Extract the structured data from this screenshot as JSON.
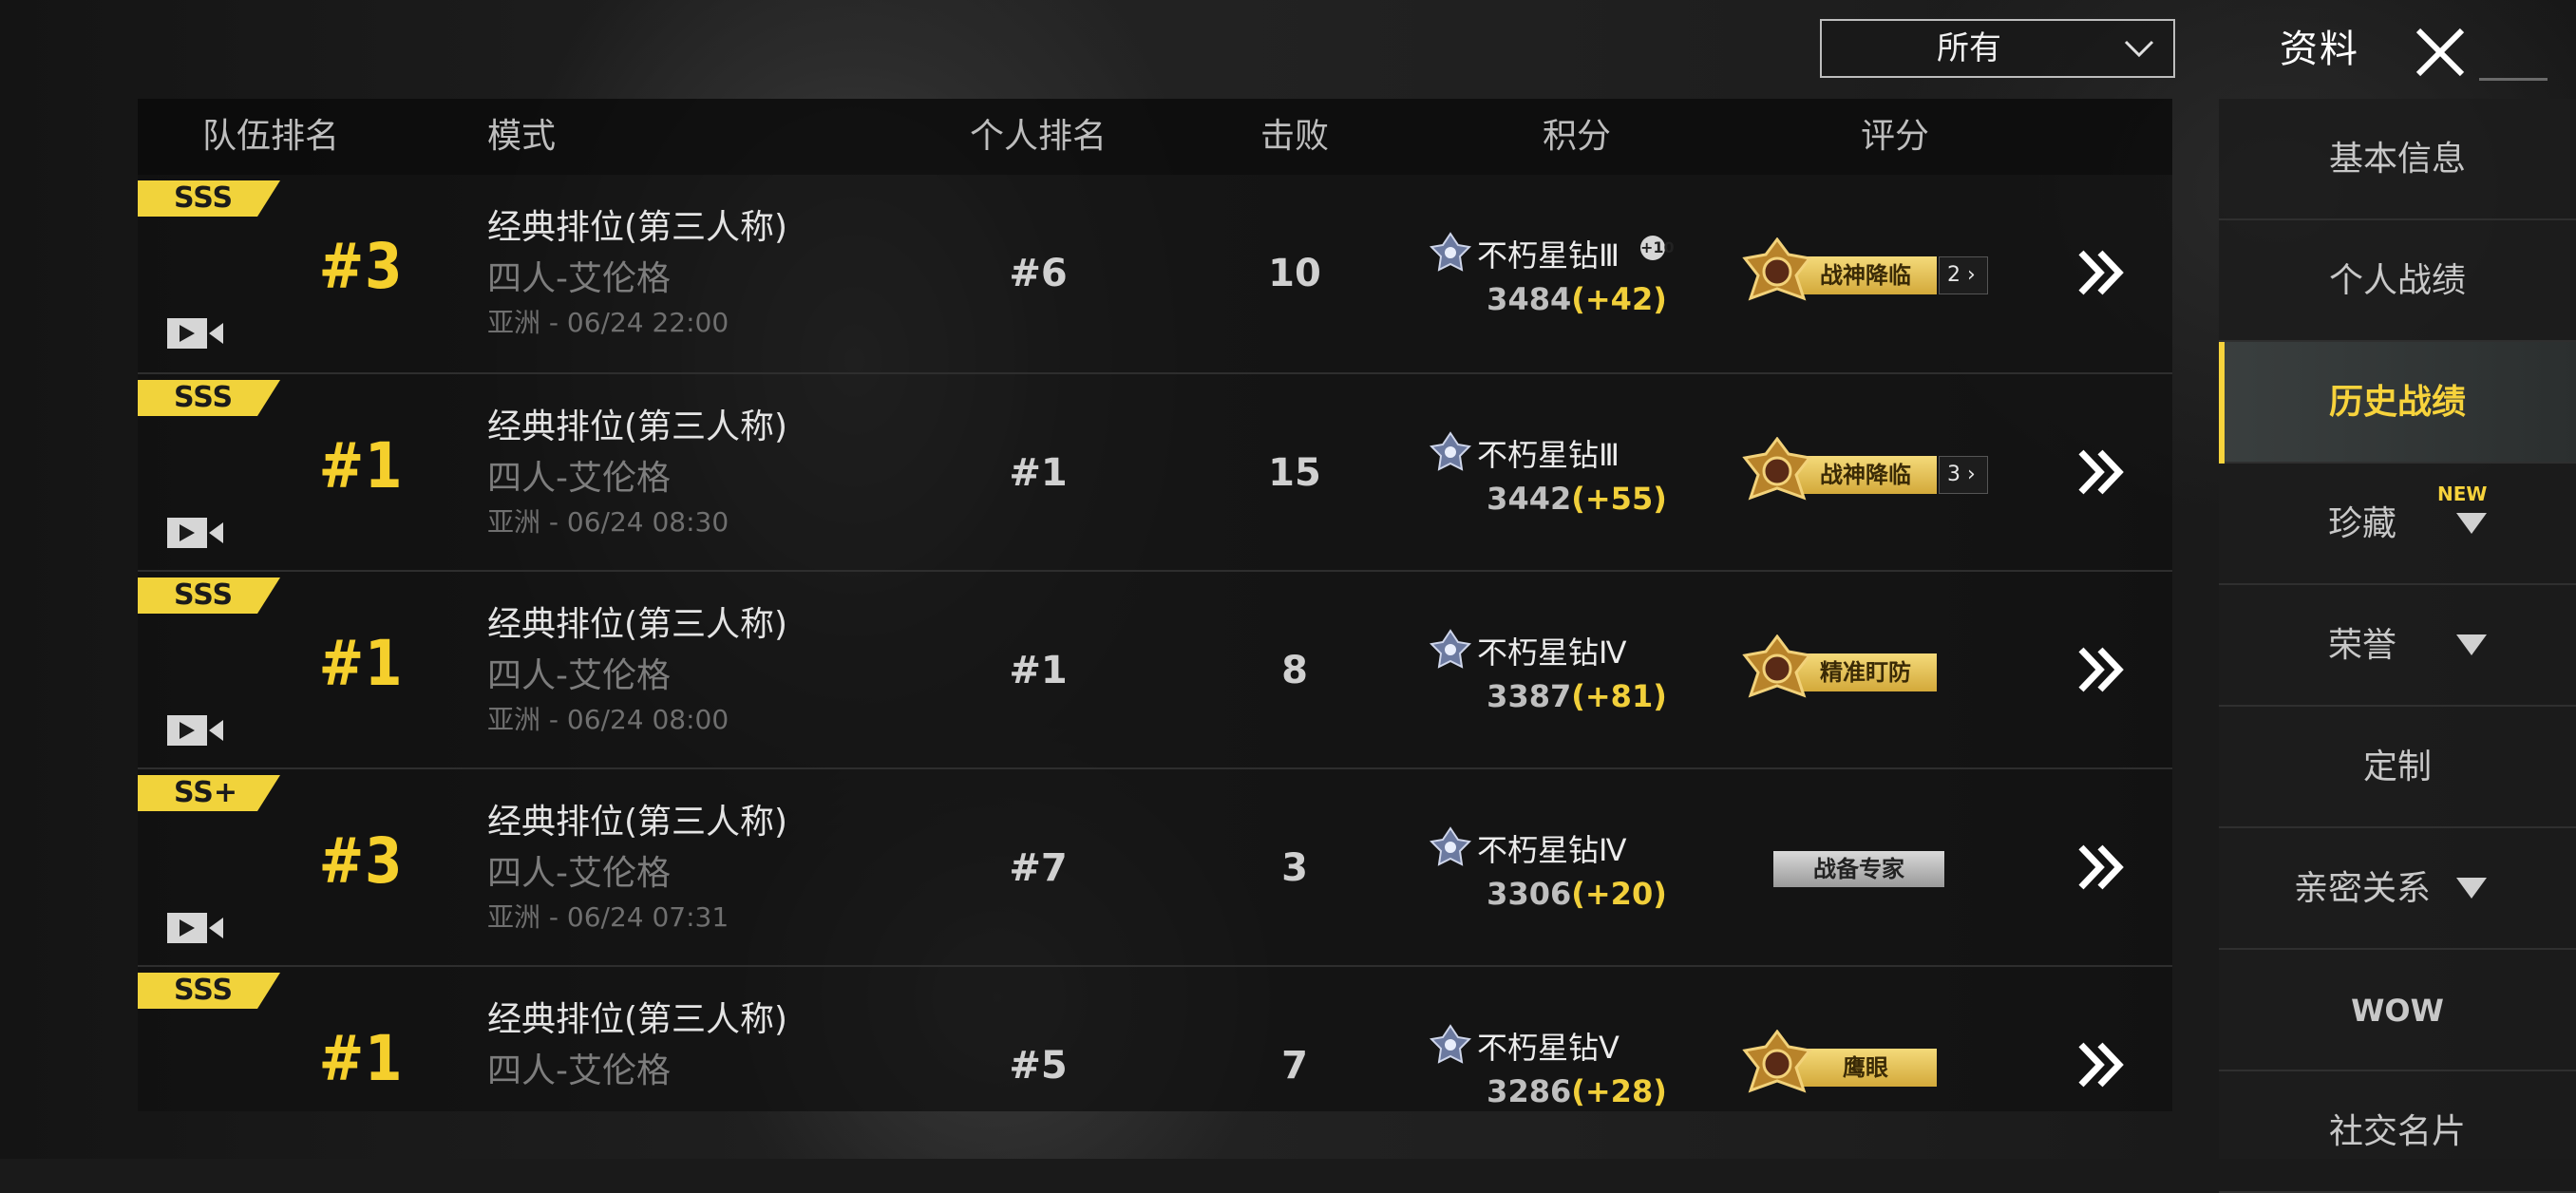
{
  "header": {
    "filter_value": "所有",
    "title": "资料"
  },
  "table": {
    "columns": [
      "队伍排名",
      "模式",
      "个人排名",
      "击败",
      "积分",
      "评分"
    ],
    "rows": [
      {
        "grade": "SSS",
        "team_rank": "#3",
        "mode": "经典排位(第三人称)",
        "map": "四人-艾伦格",
        "server_time": "亚洲 - 06/24 22:00",
        "personal_rank": "#6",
        "kills": "10",
        "tier": "不朽星钻Ⅲ",
        "tier_badge": "+10",
        "score": "3484",
        "score_delta": "(+42)",
        "medal": "战神降临",
        "medal_count": "2",
        "medal_type": "gold"
      },
      {
        "grade": "SSS",
        "team_rank": "#1",
        "mode": "经典排位(第三人称)",
        "map": "四人-艾伦格",
        "server_time": "亚洲 - 06/24 08:30",
        "personal_rank": "#1",
        "kills": "15",
        "tier": "不朽星钻Ⅲ",
        "tier_badge": "",
        "score": "3442",
        "score_delta": "(+55)",
        "medal": "战神降临",
        "medal_count": "3",
        "medal_type": "gold"
      },
      {
        "grade": "SSS",
        "team_rank": "#1",
        "mode": "经典排位(第三人称)",
        "map": "四人-艾伦格",
        "server_time": "亚洲 - 06/24 08:00",
        "personal_rank": "#1",
        "kills": "8",
        "tier": "不朽星钻Ⅳ",
        "tier_badge": "",
        "score": "3387",
        "score_delta": "(+81)",
        "medal": "精准盯防",
        "medal_count": "",
        "medal_type": "gold"
      },
      {
        "grade": "SS+",
        "team_rank": "#3",
        "mode": "经典排位(第三人称)",
        "map": "四人-艾伦格",
        "server_time": "亚洲 - 06/24 07:31",
        "personal_rank": "#7",
        "kills": "3",
        "tier": "不朽星钻Ⅳ",
        "tier_badge": "",
        "score": "3306",
        "score_delta": "(+20)",
        "medal": "战备专家",
        "medal_count": "",
        "medal_type": "plain"
      },
      {
        "grade": "SSS",
        "team_rank": "#1",
        "mode": "经典排位(第三人称)",
        "map": "四人-艾伦格",
        "server_time": "",
        "personal_rank": "#5",
        "kills": "7",
        "tier": "不朽星钻Ⅴ",
        "tier_badge": "",
        "score": "3286",
        "score_delta": "(+28)",
        "medal": "鹰眼",
        "medal_count": "",
        "medal_type": "gold"
      }
    ]
  },
  "sidebar": {
    "items": [
      {
        "label": "基本信息"
      },
      {
        "label": "个人战绩"
      },
      {
        "label": "历史战绩",
        "active": true
      },
      {
        "label": "珍藏",
        "tag": "NEW",
        "has_arrow": true
      },
      {
        "label": "荣誉",
        "has_arrow": true
      },
      {
        "label": "定制"
      },
      {
        "label": "亲密关系",
        "has_arrow": true
      },
      {
        "label": "WOW"
      },
      {
        "label": "社交名片"
      }
    ]
  },
  "colors": {
    "accent_yellow": "#f5cf2c",
    "grade_yellow": "#f1d33b",
    "panel": "#1c1c1c"
  },
  "icons": {
    "close": "close-icon",
    "dropdown": "chevron-down-icon",
    "replay": "video-replay-icon",
    "tier": "diamond-tier-icon",
    "medal": "medal-emblem-icon",
    "detail": "double-chevron-right-icon"
  }
}
